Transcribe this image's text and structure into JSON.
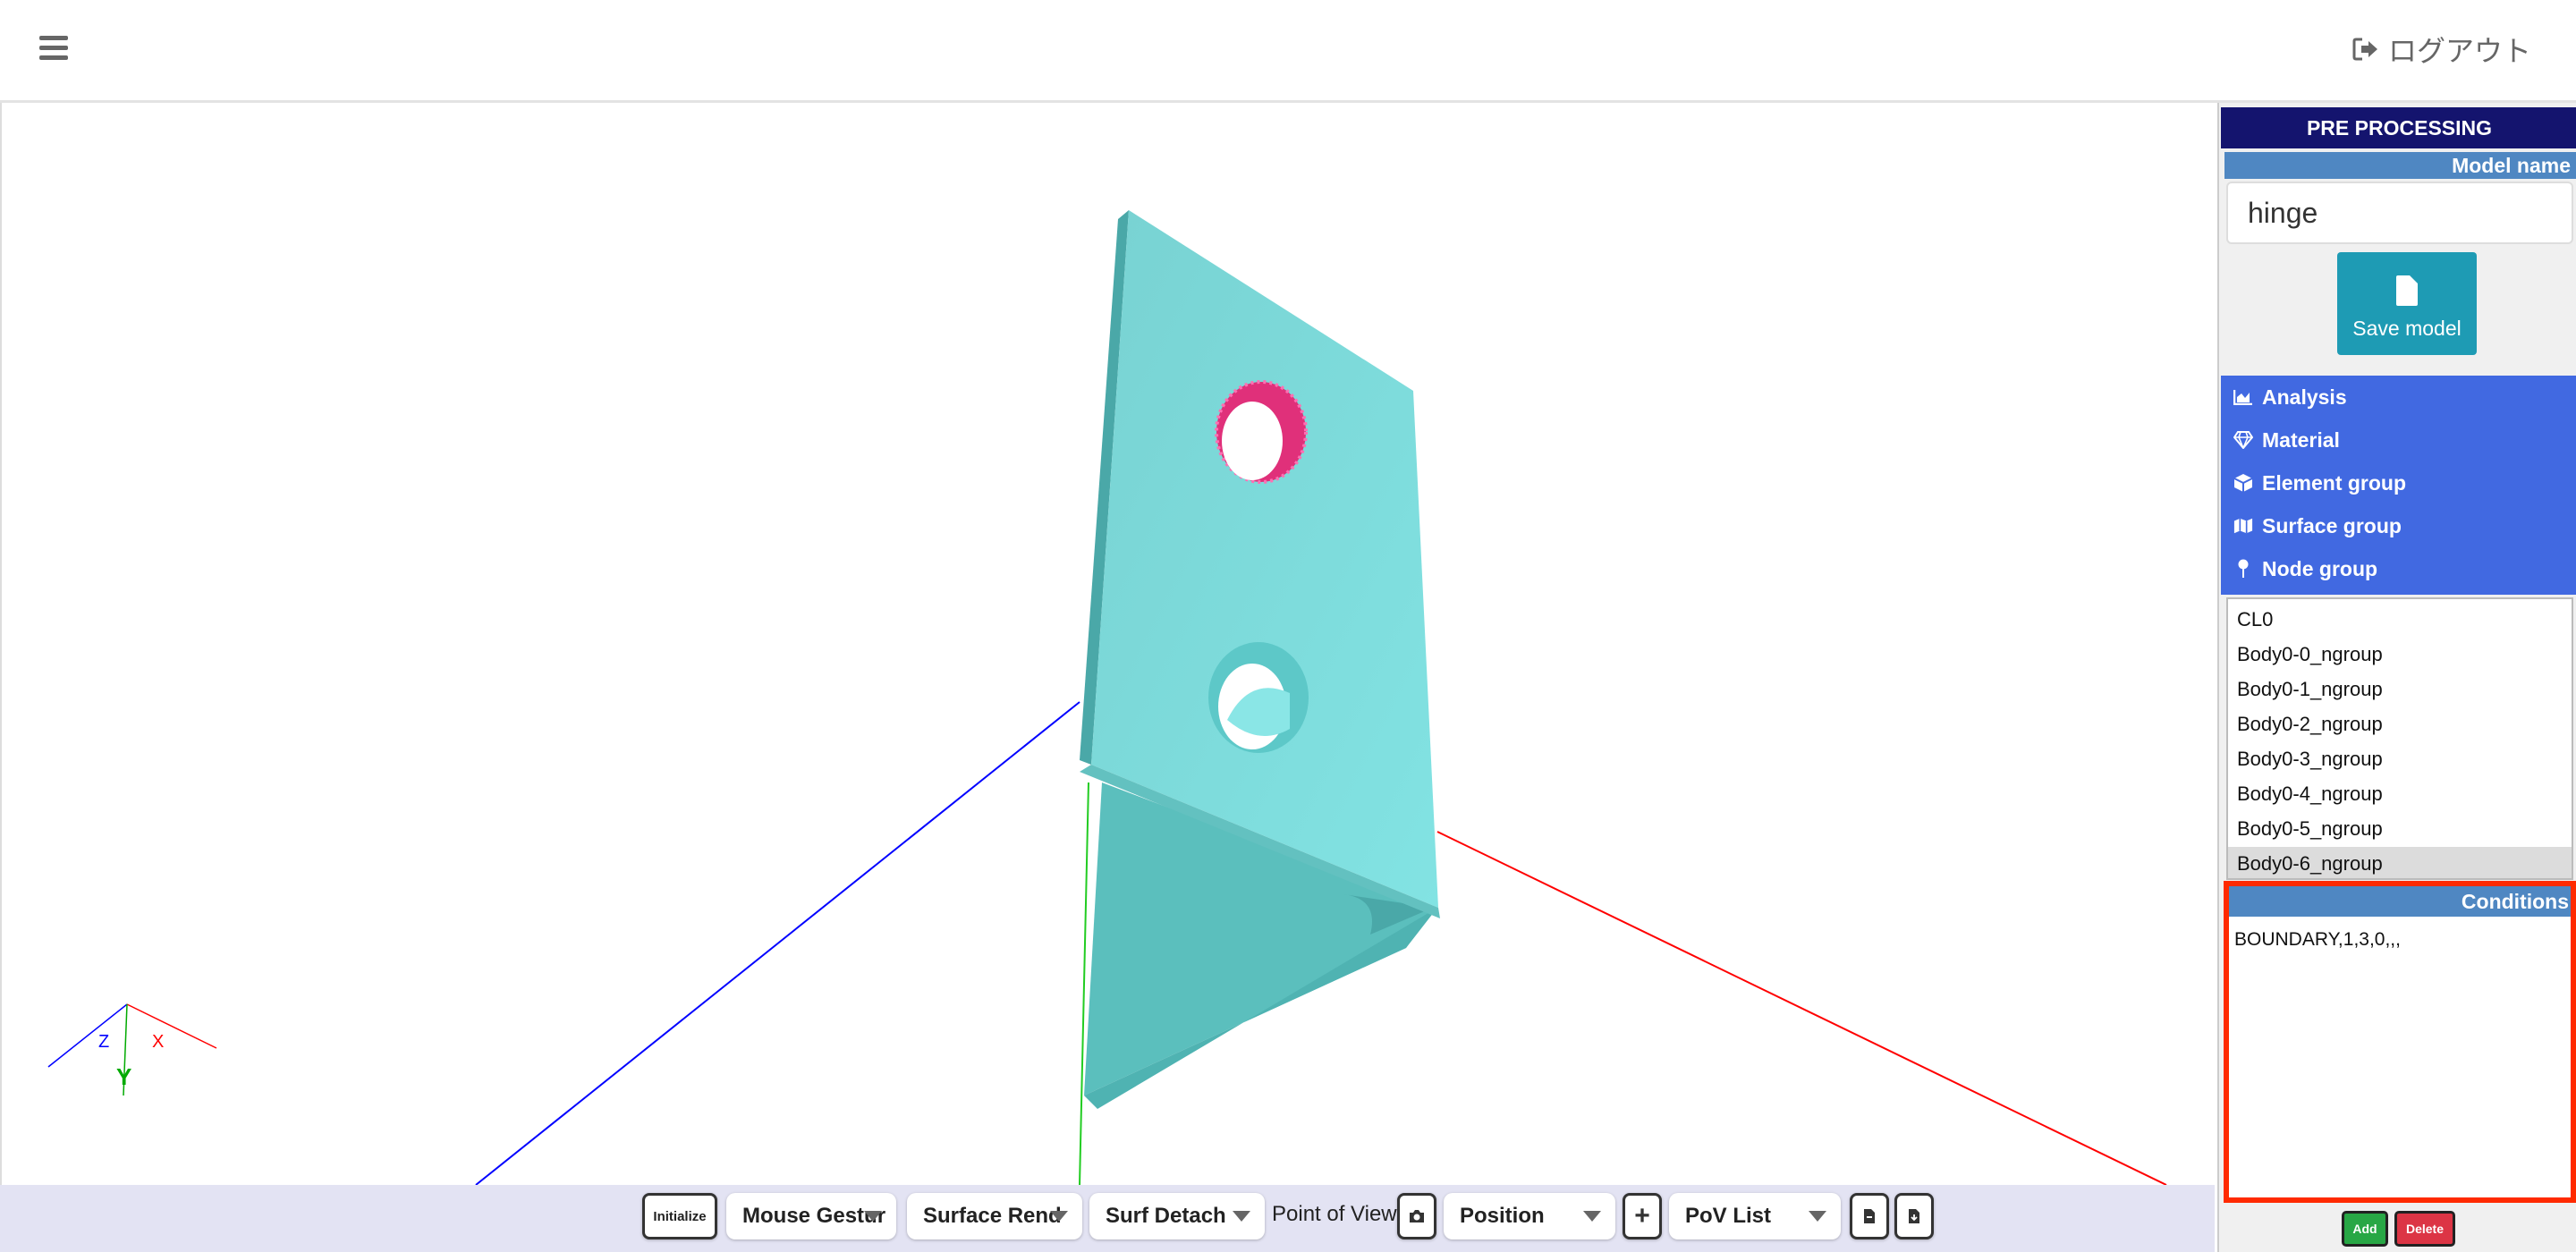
{
  "header": {
    "logout_label": "ログアウト"
  },
  "viewer": {
    "axis_labels": {
      "z": "Z",
      "x": "X",
      "y": "Y"
    },
    "colors": {
      "model": "#7dd9d9",
      "selected_surface": "#e0307a",
      "x_axis": "#ff0000",
      "y_axis": "#00aa00",
      "z_axis": "#0000ff"
    }
  },
  "toolbar": {
    "initialize_label": "Initialize",
    "mouse_gesture_label": "Mouse Gestur",
    "surface_render_label": "Surface Rend",
    "surf_detach_label": "Surf Detach",
    "point_of_view_label": "Point of View:",
    "position_label": "Position",
    "pov_list_label": "PoV List",
    "icons": [
      "camera-icon",
      "plus-icon",
      "file-export-icon",
      "file-import-icon"
    ]
  },
  "panel": {
    "title": "PRE PROCESSING",
    "model_name_label": "Model name",
    "model_name_value": "hinge",
    "save_model_label": "Save model",
    "menu": [
      {
        "label": "Analysis",
        "icon": "chart-area-icon"
      },
      {
        "label": "Material",
        "icon": "gem-icon"
      },
      {
        "label": "Element group",
        "icon": "cube-icon"
      },
      {
        "label": "Surface group",
        "icon": "map-icon"
      },
      {
        "label": "Node group",
        "icon": "pin-icon"
      }
    ],
    "node_groups": [
      "CL0",
      "Body0-0_ngroup",
      "Body0-1_ngroup",
      "Body0-2_ngroup",
      "Body0-3_ngroup",
      "Body0-4_ngroup",
      "Body0-5_ngroup",
      "Body0-6_ngroup"
    ],
    "selected_node_group": "Body0-6_ngroup",
    "conditions_label": "Conditions",
    "conditions_text": "BOUNDARY,1,3,0,,,",
    "add_label": "Add",
    "delete_label": "Delete",
    "colors": {
      "header": "#14146e",
      "menu": "#4169e1",
      "label_bar": "#4f87c2",
      "highlight": "#ff2a00",
      "save": "#1e9bb4",
      "add": "#28a745",
      "delete": "#dc3545"
    }
  }
}
